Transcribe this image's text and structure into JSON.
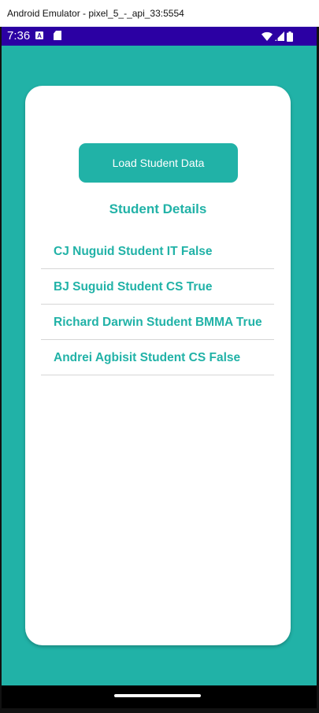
{
  "window": {
    "title": "Android Emulator - pixel_5_-_api_33:5554"
  },
  "statusbar": {
    "time": "7:36",
    "icons": [
      "a-notification-icon",
      "sd-card-icon",
      "wifi-icon",
      "signal-icon",
      "battery-icon"
    ],
    "color": "#2b00a3"
  },
  "app": {
    "load_button_label": "Load Student Data",
    "section_title": "Student Details",
    "accent_color": "#21b2a7",
    "students": [
      {
        "label": "CJ Nuguid Student IT False"
      },
      {
        "label": "BJ Suguid Student CS True"
      },
      {
        "label": "Richard Darwin Student BMMA True"
      },
      {
        "label": "Andrei Agbisit Student CS False"
      }
    ]
  }
}
